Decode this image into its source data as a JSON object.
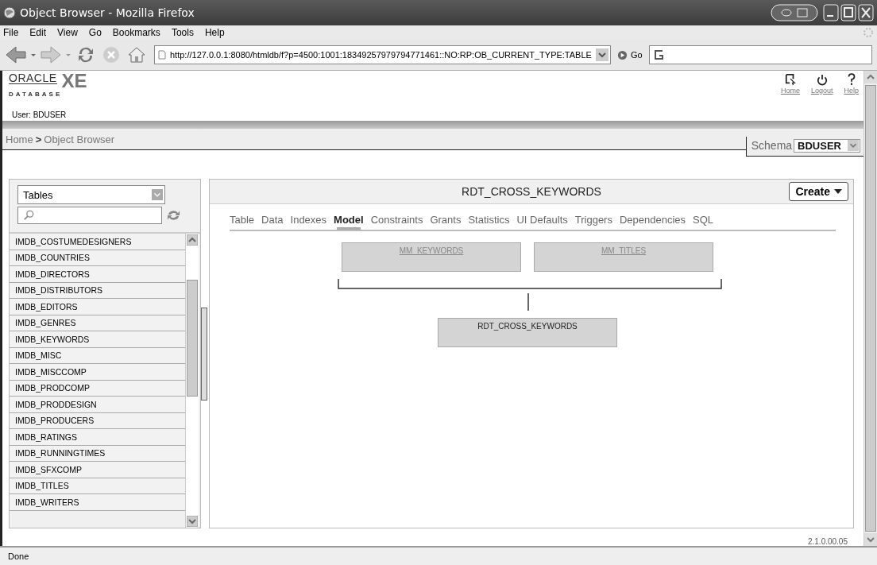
{
  "window": {
    "title": "Object Browser - Mozilla Firefox"
  },
  "menu": [
    "File",
    "Edit",
    "View",
    "Go",
    "Bookmarks",
    "Tools",
    "Help"
  ],
  "toolbar": {
    "url": "http://127.0.0.1:8080/htmldb/f?p=4500:1001:18349257979794771461::NO:RP:OB_CURRENT_TYPE:TABLE",
    "go": "Go"
  },
  "header": {
    "logo_top": "ORACLE",
    "logo_product": "XE",
    "logo_bottom": "DATABASE",
    "user": "User: BDUSER",
    "links": [
      {
        "label": "Home",
        "kind": "home"
      },
      {
        "label": "Logout",
        "kind": "logout"
      },
      {
        "label": "Help",
        "kind": "help"
      }
    ]
  },
  "breadcrumb": {
    "home": "Home",
    "separator": ">",
    "current": "Object Browser"
  },
  "schema": {
    "label": "Schema",
    "value": "BDUSER"
  },
  "object_type": "Tables",
  "object_list": [
    "IMDB_COSTUMEDESIGNERS",
    "IMDB_COUNTRIES",
    "IMDB_DIRECTORS",
    "IMDB_DISTRIBUTORS",
    "IMDB_EDITORS",
    "IMDB_GENRES",
    "IMDB_KEYWORDS",
    "IMDB_MISC",
    "IMDB_MISCCOMP",
    "IMDB_PRODCOMP",
    "IMDB_PRODDESIGN",
    "IMDB_PRODUCERS",
    "IMDB_RATINGS",
    "IMDB_RUNNINGTIMES",
    "IMDB_SFXCOMP",
    "IMDB_TITLES",
    "IMDB_WRITERS"
  ],
  "object": {
    "title": "RDT_CROSS_KEYWORDS",
    "create": "Create",
    "tabs": [
      {
        "label": "Table",
        "selected": false
      },
      {
        "label": "Data",
        "selected": false
      },
      {
        "label": "Indexes",
        "selected": false
      },
      {
        "label": "Model",
        "selected": true
      },
      {
        "label": "Constraints",
        "selected": false
      },
      {
        "label": "Grants",
        "selected": false
      },
      {
        "label": "Statistics",
        "selected": false
      },
      {
        "label": "UI Defaults",
        "selected": false
      },
      {
        "label": "Triggers",
        "selected": false
      },
      {
        "label": "Dependencies",
        "selected": false
      },
      {
        "label": "SQL",
        "selected": false
      }
    ]
  },
  "model": {
    "parents": [
      "MM_KEYWORDS",
      "MM_TITLES"
    ],
    "table": "RDT_CROSS_KEYWORDS"
  },
  "version": "2.1.0.00.05",
  "status_bar": "Done"
}
